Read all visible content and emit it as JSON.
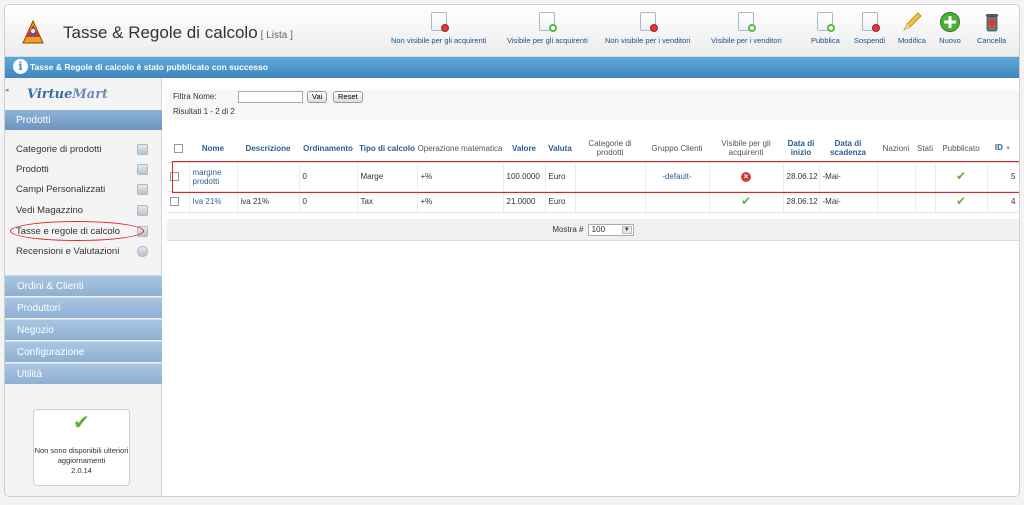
{
  "header": {
    "title": "Tasse & Regole di calcolo",
    "subtitle": "[ Lista ]"
  },
  "toolbar": [
    {
      "label": "Non visibile per gli acquirenti",
      "icon": "doc-red-dot-icon"
    },
    {
      "label": "Visibile per gli acquirenti",
      "icon": "doc-green-dot-icon"
    },
    {
      "label": "Non visibile per i venditori",
      "icon": "doc-red-dot-icon"
    },
    {
      "label": "Visibile per i venditori",
      "icon": "doc-green-dot-icon"
    },
    {
      "label": "Pubblica",
      "icon": "doc-green-dot-icon"
    },
    {
      "label": "Sospendi",
      "icon": "doc-red-dot-icon"
    },
    {
      "label": "Modifica",
      "icon": "pencil-icon"
    },
    {
      "label": "Nuovo",
      "icon": "plus-circle-icon"
    },
    {
      "label": "Cancella",
      "icon": "trash-icon"
    }
  ],
  "message": "Tasse & Regole di calcolo è stato pubblicato con successo",
  "sidebar": {
    "logo_main": "Virtue",
    "logo_accent": "Mart",
    "section_title": "Prodotti",
    "items": [
      {
        "label": "Categorie di prodotti"
      },
      {
        "label": "Prodotti"
      },
      {
        "label": "Campi Personalizzati"
      },
      {
        "label": "Vedi Magazzino"
      },
      {
        "label": "Tasse e regole di calcolo"
      },
      {
        "label": "Recensioni e Valutazioni"
      }
    ],
    "sections": [
      "Ordini & Clienti",
      "Produttori",
      "Negozio",
      "Configurazione",
      "Utilità"
    ],
    "update_box": {
      "text": "Non sono disponibili ulteriori aggiornamenti",
      "version": "2.0.14"
    }
  },
  "filter": {
    "label": "Filtra Nome:",
    "value": "",
    "go_label": "Vai",
    "reset_label": "Reset",
    "results": "Risultati 1 - 2 di 2"
  },
  "table": {
    "columns": [
      "Nome",
      "Descrizione",
      "Ordinamento",
      "Tipo di calcolo",
      "Operazione matematica",
      "Valore",
      "Valuta",
      "Categorie di prodotti",
      "Gruppo Clienti",
      "Visibile per gli acquirenti",
      "Data di inizio",
      "Data di scadenza",
      "Nazioni",
      "Stati",
      "Pubblicato",
      "ID"
    ],
    "rows": [
      {
        "name": "margine prodotti",
        "description": "",
        "order": "0",
        "calc_type": "Marge",
        "math_op": "+%",
        "value": "100.0000",
        "currency": "Euro",
        "categories": "",
        "group": "-default-",
        "visible_buyers": "no",
        "start": "28.06.12",
        "end": "-Mai-",
        "countries": "",
        "states": "",
        "published": "yes",
        "id": "5"
      },
      {
        "name": "Iva 21%",
        "description": "iva 21%",
        "order": "0",
        "calc_type": "Tax",
        "math_op": "+%",
        "value": "21.0000",
        "currency": "Euro",
        "categories": "",
        "group": "",
        "visible_buyers": "yes",
        "start": "28.06.12",
        "end": "-Mai-",
        "countries": "",
        "states": "",
        "published": "yes",
        "id": "4"
      }
    ]
  },
  "pagination": {
    "label": "Mostra #",
    "value": "100"
  }
}
